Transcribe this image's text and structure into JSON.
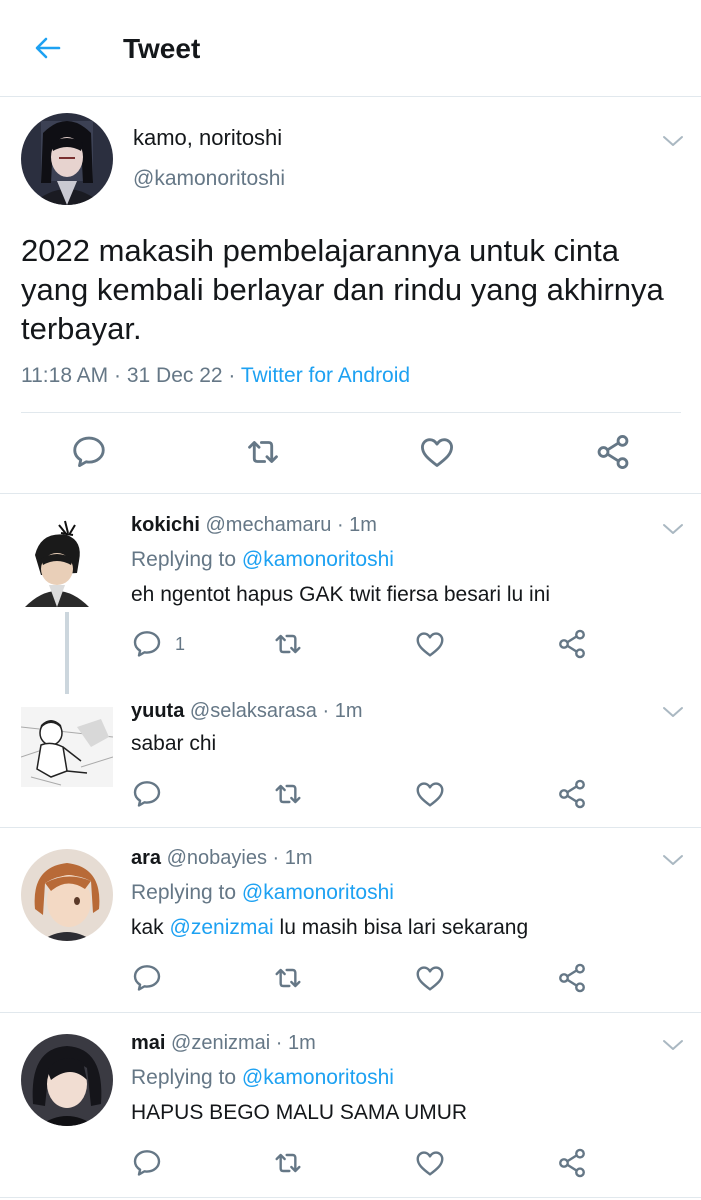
{
  "header": {
    "title": "Tweet"
  },
  "main_tweet": {
    "name": "kamo, noritoshi",
    "handle": "@kamonoritoshi",
    "text": "2022 makasih pembelajarannya untuk cinta yang kembali berlayar dan rindu yang akhirnya terbayar.",
    "time": "11:18 AM · 31 Dec 22 · ",
    "source": "Twitter for Android"
  },
  "replies": [
    {
      "name": "kokichi",
      "handle": "@mechamaru · 1m",
      "replying_label": "Replying to",
      "replying_to": "@kamonoritoshi",
      "text": "eh ngentot hapus GAK twit fiersa besari lu ini",
      "reply_count": "1"
    },
    {
      "name": "yuuta",
      "handle": "@selaksarasa · 1m",
      "text": "sabar chi"
    },
    {
      "name": "ara",
      "handle": "@nobayies · 1m",
      "replying_label": "Replying to",
      "replying_to": "@kamonoritoshi",
      "text_prefix": "kak ",
      "text_mention": "@zenizmai",
      "text_suffix": " lu masih bisa lari sekarang"
    },
    {
      "name": "mai",
      "handle": "@zenizmai · 1m",
      "replying_label": "Replying to",
      "replying_to": "@kamonoritoshi",
      "text": "HAPUS BEGO MALU SAMA UMUR"
    }
  ],
  "colors": {
    "accent": "#1da1f2",
    "secondary_text": "#657786",
    "divider": "#e1e8ed"
  },
  "icons": [
    "back-arrow-icon",
    "reply-icon",
    "retweet-icon",
    "like-icon",
    "share-icon",
    "chevron-down-icon"
  ]
}
